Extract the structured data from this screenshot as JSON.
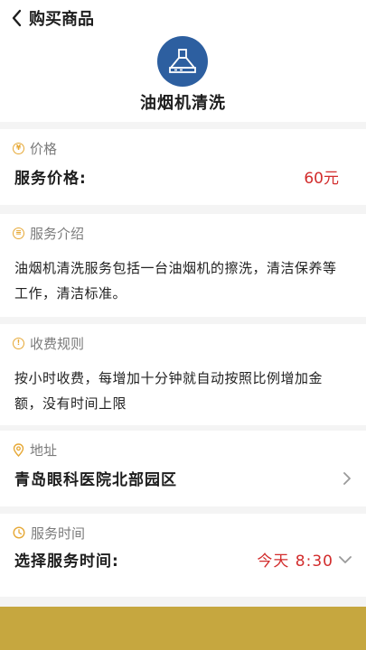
{
  "header": {
    "back_title": "购买商品",
    "service_name": "油烟机清洗",
    "service_icon": "range-hood-icon"
  },
  "price": {
    "section_title": "价格",
    "label": "服务价格:",
    "value": "60元"
  },
  "intro": {
    "section_title": "服务介绍",
    "text": "油烟机清洗服务包括一台油烟机的擦洗，清洁保养等工作，清洁标准。"
  },
  "rules": {
    "section_title": "收费规则",
    "text": "按小时收费，每增加十分钟就自动按照比例增加金额，没有时间上限"
  },
  "address": {
    "section_title": "地址",
    "value": "青岛眼科医院北部园区"
  },
  "time": {
    "section_title": "服务时间",
    "label": "选择服务时间:",
    "value": "今天 8:30"
  },
  "colors": {
    "accent_gold": "#c6a73f",
    "icon_orange": "#e6a835",
    "price_red": "#d22c2c",
    "icon_blue": "#2d5fa0"
  }
}
